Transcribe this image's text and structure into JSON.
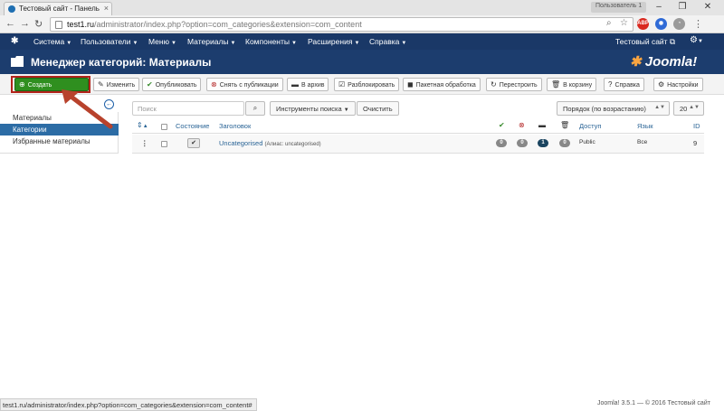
{
  "browser": {
    "tab_title": "Тестовый сайт - Панель",
    "user_badge": "Пользователь 1",
    "url_host": "test1.ru",
    "url_path": "/administrator/index.php?option=com_categories&extension=com_content",
    "ext_abp": "ABP"
  },
  "navbar": {
    "items": [
      {
        "label": "Система"
      },
      {
        "label": "Пользователи"
      },
      {
        "label": "Меню"
      },
      {
        "label": "Материалы"
      },
      {
        "label": "Компоненты"
      },
      {
        "label": "Расширения"
      },
      {
        "label": "Справка"
      }
    ],
    "site_name": "Тестовый сайт"
  },
  "header": {
    "title": "Менеджер категорий: Материалы",
    "brand": "Joomla!"
  },
  "toolbar": {
    "new": "Создать",
    "edit": "Изменить",
    "publish": "Опубликовать",
    "unpublish": "Снять с публикации",
    "archive": "В архив",
    "checkin": "Разблокировать",
    "batch": "Пакетная обработка",
    "rebuild": "Перестроить",
    "trash": "В корзину",
    "help": "Справка",
    "options": "Настройки"
  },
  "sidebar": {
    "items": [
      {
        "label": "Материалы",
        "active": false
      },
      {
        "label": "Категории",
        "active": true
      },
      {
        "label": "Избранные материалы",
        "active": false
      }
    ]
  },
  "filters": {
    "search_placeholder": "Поиск",
    "search_tools": "Инструменты поиска",
    "clear": "Очистить",
    "ordering": "Порядок (по возрастанию)",
    "limit": "20"
  },
  "table": {
    "headers": {
      "status": "Состояние",
      "title": "Заголовок",
      "access": "Доступ",
      "language": "Язык",
      "id": "ID"
    },
    "rows": [
      {
        "title": "Uncategorised",
        "alias": "(Алиас: uncategorised)",
        "published": "0",
        "unpublished": "0",
        "archived": "1",
        "trashed": "0",
        "access": "Public",
        "language": "Все",
        "id": "9"
      }
    ]
  },
  "statusbar": {
    "url": "test1.ru/administrator/index.php?option=com_categories&extension=com_content#"
  },
  "footer": {
    "text": "Joomla! 3.5.1 — © 2016 Тестовый сайт"
  }
}
